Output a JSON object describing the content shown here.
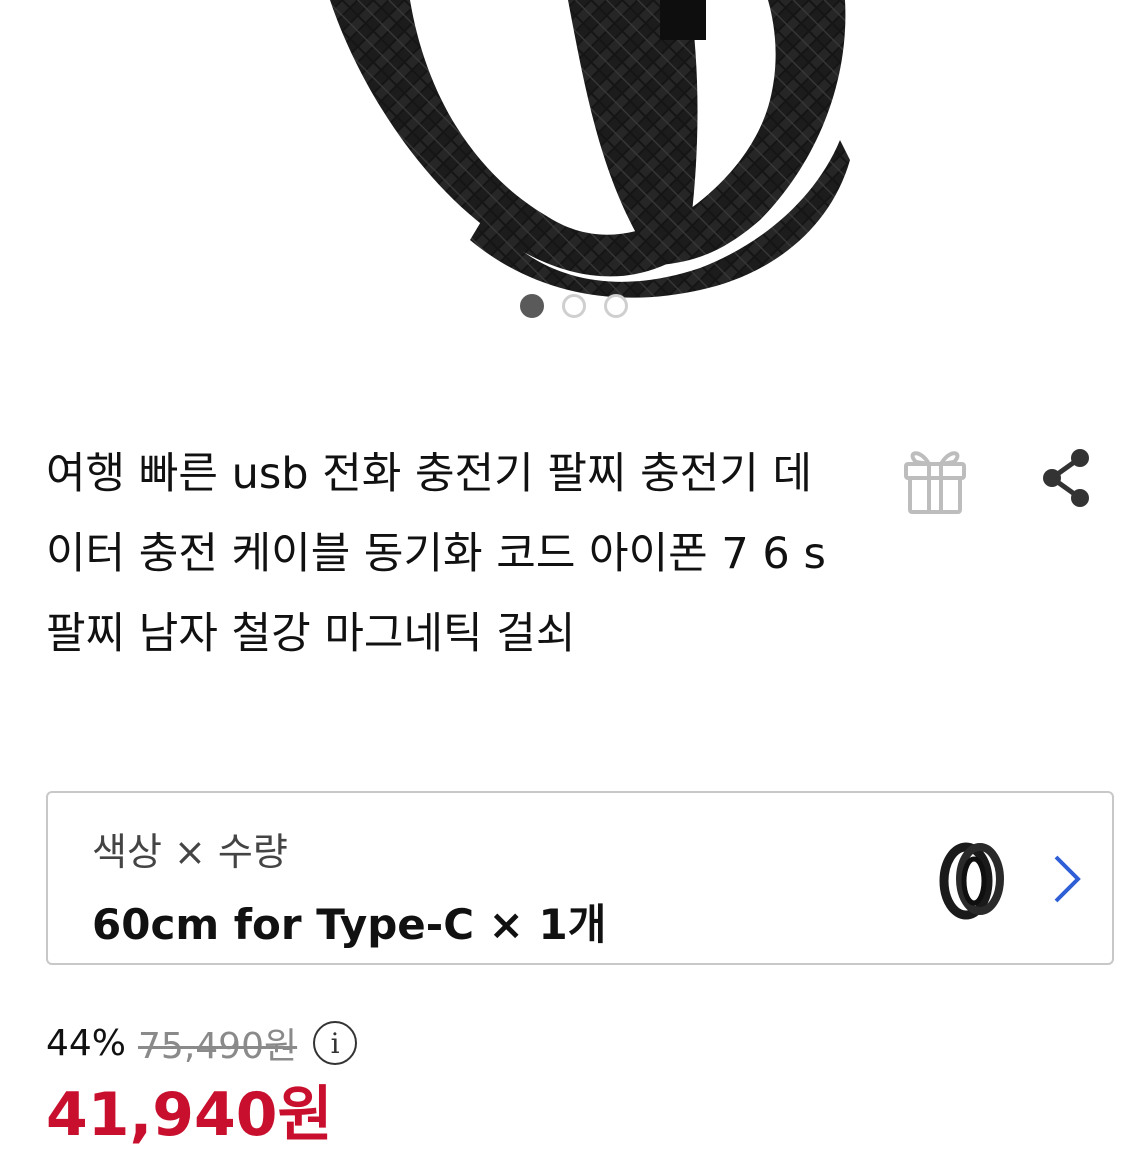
{
  "product": {
    "title": "여행 빠른 usb 전화 충전기 팔찌 충전기 데이터 충전 케이블 동기화 코드 아이폰 7 6 s 팔찌 남자 철강 마그네틱 걸쇠",
    "carousel": {
      "total": 3,
      "active": 1
    }
  },
  "icons": {
    "gift": "gift-icon",
    "share": "share-icon",
    "chevron": "chevron-right-icon",
    "info": "info-icon"
  },
  "option": {
    "label": "색상 × 수량",
    "value": "60cm for Type-C × 1개"
  },
  "price": {
    "discount": "44%",
    "original": "75,490원",
    "final": "41,940원",
    "info_glyph": "i"
  },
  "colors": {
    "price_red": "#c8102e",
    "border": "#c8c8c8",
    "dot_active": "#5a5a5a"
  }
}
